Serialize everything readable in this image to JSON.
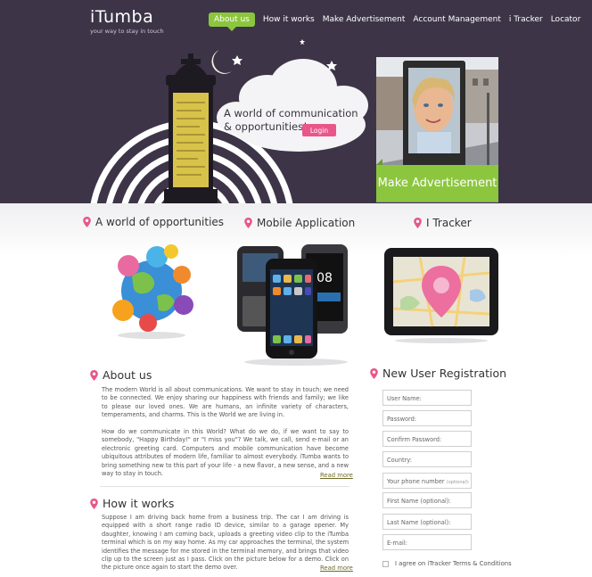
{
  "brand": {
    "name": "iTumba",
    "tagline": "your way to stay in touch"
  },
  "nav": [
    {
      "label": "About us",
      "active": true
    },
    {
      "label": "How it works"
    },
    {
      "label": "Make Advertisement"
    },
    {
      "label": "Account Management"
    },
    {
      "label": "i Tracker"
    },
    {
      "label": "Locator"
    }
  ],
  "hero": {
    "cloud_line1": "A world of communication",
    "cloud_line2": "& opportunities!",
    "login_label": "Login",
    "make_ad_label": "Make Advertisement"
  },
  "features": [
    {
      "title": "A world of opportunities"
    },
    {
      "title": "Mobile Application"
    },
    {
      "title": "I Tracker"
    }
  ],
  "about": {
    "title": "About us",
    "p1": "The modern World is all about communications. We want to stay in touch; we need to be connected. We enjoy sharing our happiness with friends and family; we like to please our loved ones. We are humans, an infinite variety of characters, temperaments, and charms. This is the World we are living in.",
    "p2": "How do we communicate in this World? What do we do, if we want to say to somebody, \"Happy Birthday!\" or \"I miss you\"? We talk, we call, send e-mail or an electronic greeting card. Computers and mobile communication have become ubiquitous attributes of modern life, familiar to almost everybody. iTumba wants to bring something new to this part of your life - a new flavor, a new sense, and a new way to stay in touch.",
    "read_more": "Read more"
  },
  "how": {
    "title": "How it works",
    "p1": "Suppose I am driving back home from a business trip. The car I am driving is equipped with a short range radio ID device, similar to a garage opener. My daughter, knowing I am coming back, uploads a greeting video clip to the iTumba terminal which is on my way home. As my car approaches the terminal, the system identifies the message for me stored in the terminal memory, and brings that video clip up to the screen just as I pass. Click on the picture below for a demo. Click on the picture once again to start the demo over.",
    "read_more": "Read more"
  },
  "registration": {
    "title": "New User Registration",
    "fields": [
      {
        "placeholder": "User Name:"
      },
      {
        "placeholder": "Password:"
      },
      {
        "placeholder": "Confirm Password:"
      },
      {
        "placeholder": "Country:"
      },
      {
        "placeholder": "Your phone number",
        "note": "(optional):"
      },
      {
        "placeholder": "First Name (optional):"
      },
      {
        "placeholder": "Last Name (optional):"
      },
      {
        "placeholder": "E-mail:"
      }
    ],
    "terms_label": "I agree on iTracker Terms & Conditions"
  },
  "colors": {
    "header_bg": "#3d3547",
    "accent_green": "#8cc63f",
    "accent_pink": "#e8568a"
  }
}
